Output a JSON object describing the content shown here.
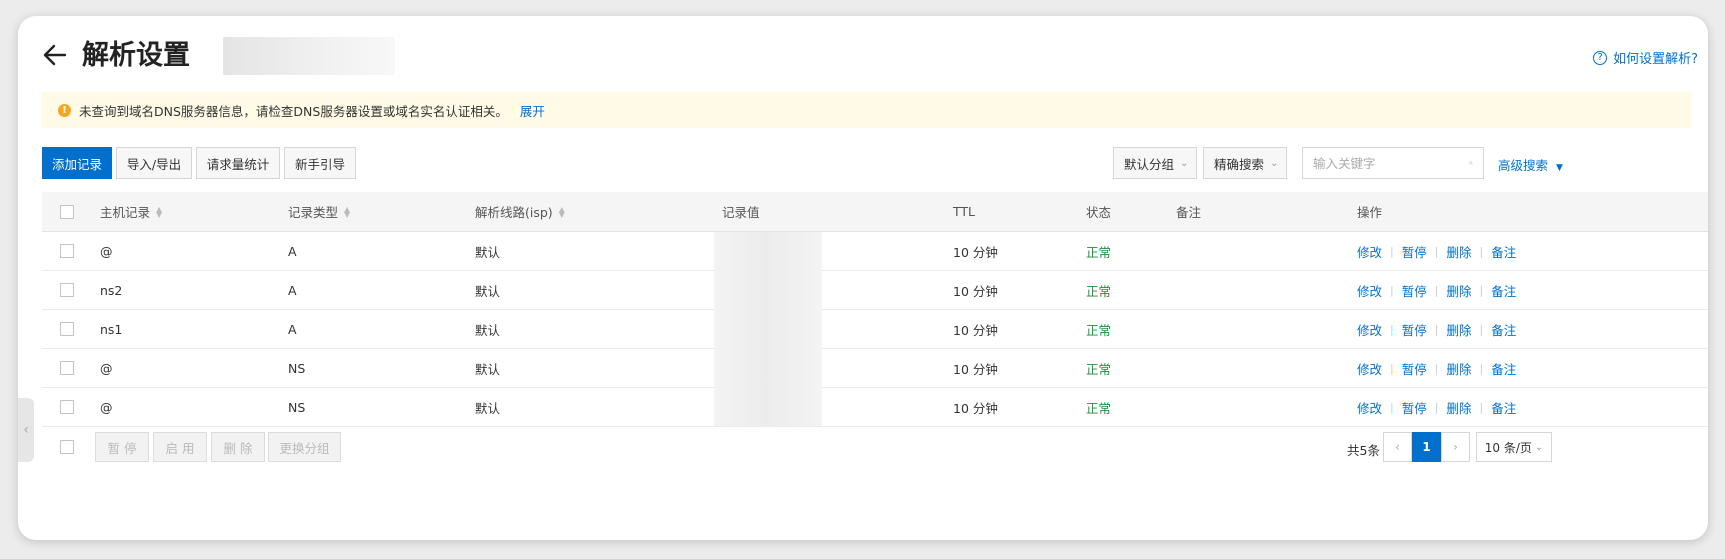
{
  "header": {
    "title": "解析设置",
    "help_text": "如何设置解析?"
  },
  "notice": {
    "text": "未查询到域名DNS服务器信息，请检查DNS服务器设置或域名实名认证相关。",
    "expand": "展开"
  },
  "toolbar": {
    "add": "添加记录",
    "import_export": "导入/导出",
    "request_stats": "请求量统计",
    "guide": "新手引导",
    "group_select": "默认分组",
    "search_mode": "精确搜索",
    "search_placeholder": "输入关键字",
    "advanced_search": "高级搜索"
  },
  "table": {
    "columns": {
      "host": "主机记录",
      "type": "记录类型",
      "line": "解析线路(isp)",
      "value": "记录值",
      "ttl": "TTL",
      "status": "状态",
      "remark": "备注",
      "ops": "操作"
    },
    "rows": [
      {
        "host": "@",
        "type": "A",
        "line": "默认",
        "ttl": "10 分钟",
        "status": "正常"
      },
      {
        "host": "ns2",
        "type": "A",
        "line": "默认",
        "ttl": "10 分钟",
        "status": "正常"
      },
      {
        "host": "ns1",
        "type": "A",
        "line": "默认",
        "ttl": "10 分钟",
        "status": "正常"
      },
      {
        "host": "@",
        "type": "NS",
        "line": "默认",
        "ttl": "10 分钟",
        "status": "正常"
      },
      {
        "host": "@",
        "type": "NS",
        "line": "默认",
        "ttl": "10 分钟",
        "status": "正常"
      }
    ],
    "actions": {
      "edit": "修改",
      "pause": "暂停",
      "delete": "删除",
      "remark": "备注"
    }
  },
  "footer": {
    "pause": "暂 停",
    "enable": "启 用",
    "delete": "删 除",
    "change_group": "更换分组",
    "total": "共5条",
    "current_page": "1",
    "page_size": "10 条/页"
  },
  "colors": {
    "accent": "#0070cc",
    "status_ok": "#1e8e3e",
    "warning": "#f5a623",
    "notice_bg": "#fffbe6"
  }
}
